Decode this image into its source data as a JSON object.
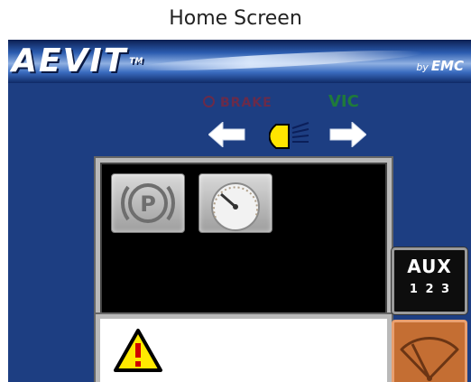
{
  "caption": "Home Screen",
  "header": {
    "logo": "AEVIT",
    "trademark": "TM",
    "by_label": "by",
    "brand": "EMC"
  },
  "indicators": {
    "brake_label": "BRAKE",
    "vic_label": "VIC",
    "left_turn_icon": "left-arrow-icon",
    "right_turn_icon": "right-arrow-icon",
    "headlight_icon": "headlight-icon"
  },
  "panel": {
    "tiles": [
      {
        "name": "parking-brake",
        "icon": "parking-brake-icon"
      },
      {
        "name": "speedometer",
        "icon": "speedometer-icon"
      }
    ]
  },
  "warning": {
    "icon": "warning-triangle-icon"
  },
  "aux_button": {
    "label": "AUX",
    "numbers": "1 2 3"
  },
  "wiper_button": {
    "icon": "wiper-icon"
  },
  "colors": {
    "screen_bg": "#1d3e82",
    "brake": "#6a2b4a",
    "vic": "#1f7a3a",
    "headlight": "#ffe500",
    "wiper_button": "#c46e33"
  }
}
